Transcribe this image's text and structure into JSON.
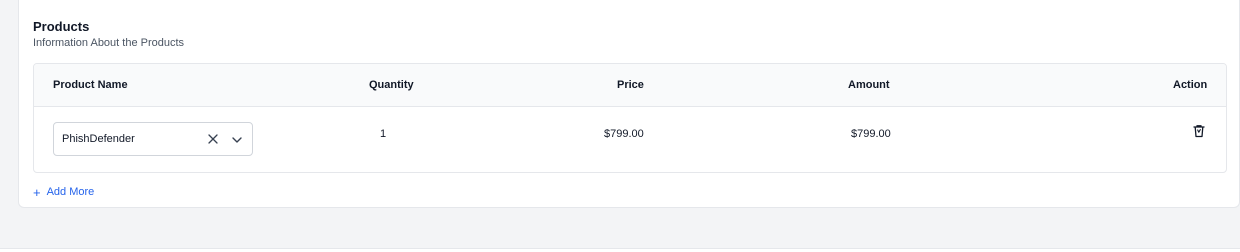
{
  "section": {
    "title": "Products",
    "subtitle": "Information About the Products"
  },
  "table": {
    "headers": {
      "product_name": "Product Name",
      "quantity": "Quantity",
      "price": "Price",
      "amount": "Amount",
      "action": "Action"
    },
    "rows": [
      {
        "product": "PhishDefender",
        "quantity": "1",
        "price": "$799.00",
        "amount": "$799.00"
      }
    ]
  },
  "add_more": {
    "label": "Add More",
    "icon": "plus-icon"
  },
  "colors": {
    "accent": "#2563eb",
    "border": "#e5e7eb",
    "header_bg": "#f9fafb",
    "page_bg": "#f3f4f6"
  }
}
